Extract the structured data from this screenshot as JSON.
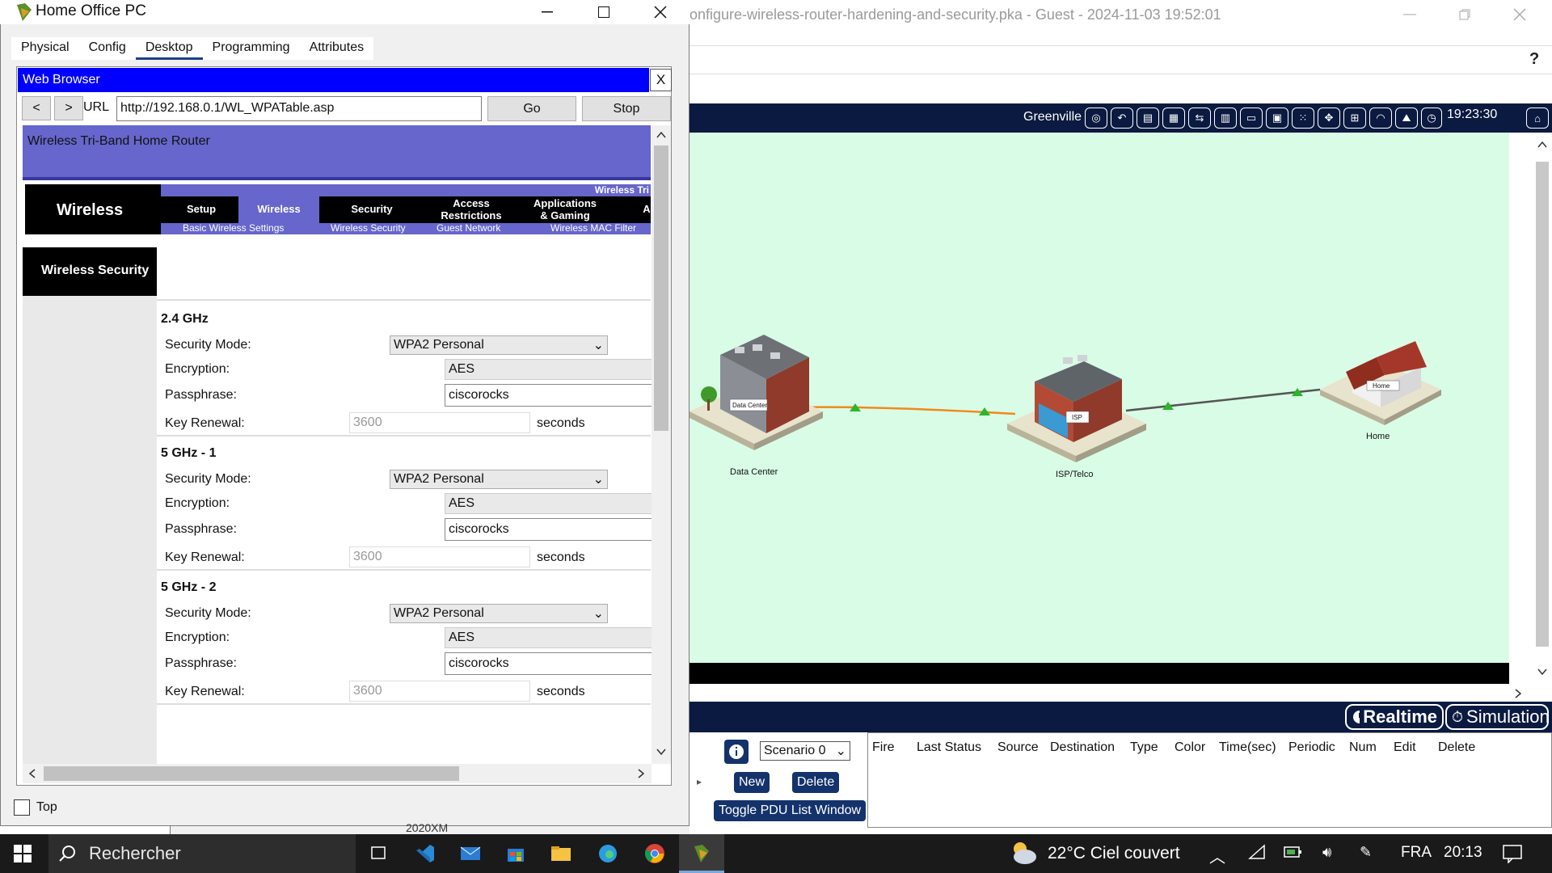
{
  "background_window": {
    "title": "onfigure-wireless-router-hardening-and-security.pka - Guest - 2024-11-03 19:52:01",
    "help_symbol": "?"
  },
  "topology_toolbar": {
    "location": "Greenville",
    "time": "19:23:30",
    "icons": [
      "navigation-icon",
      "undo-icon",
      "cluster-icon",
      "new-cluster-icon",
      "move-object-icon",
      "set-tiled-icon",
      "viewport-icon",
      "wireless-icon",
      "environment-icon",
      "clock-icon",
      "home-icon"
    ]
  },
  "topology": {
    "nodes": [
      {
        "name": "Data Center",
        "sign": "Data Center"
      },
      {
        "name": "ISP/Telco",
        "sign": "ISP"
      },
      {
        "name": "Home",
        "sign": "Home"
      }
    ],
    "link_colors": {
      "dc_isp": "#f08a1a",
      "isp_home": "#555555",
      "endpoint": "#2bb52b"
    }
  },
  "mode_buttons": {
    "realtime": "Realtime",
    "simulation": "Simulation"
  },
  "pdu_panel": {
    "scenario": "Scenario 0",
    "new_label": "New",
    "delete_label": "Delete",
    "toggle_label": "Toggle PDU List Window",
    "columns": [
      "Fire",
      "Last Status",
      "Source",
      "Destination",
      "Type",
      "Color",
      "Time(sec)",
      "Periodic",
      "Num",
      "Edit",
      "Delete"
    ]
  },
  "taskbar": {
    "search_placeholder": "Rechercher",
    "weather": "22°C  Ciel couvert",
    "language": "FRA",
    "time": "20:13"
  },
  "hopc": {
    "title": "Home Office PC",
    "tabs": [
      "Physical",
      "Config",
      "Desktop",
      "Programming",
      "Attributes"
    ],
    "active_tab": "Desktop",
    "top_label": "Top",
    "under_text": "2020XM"
  },
  "browser": {
    "title": "Web Browser",
    "close": "X",
    "back": "<",
    "forward": ">",
    "url_label": "URL",
    "url": "http://192.168.0.1/WL_WPATable.asp",
    "go": "Go",
    "stop": "Stop"
  },
  "router_page": {
    "banner": "Wireless Tri-Band Home Router",
    "nav_title": "Wireless",
    "strip_text": "Wireless Tri",
    "nav_items": [
      "Setup",
      "Wireless",
      "Security",
      "Access\nRestrictions",
      "Applications\n& Gaming",
      "A"
    ],
    "sub_items": [
      "Basic Wireless Settings",
      "Wireless Security",
      "Guest Network",
      "Wireless MAC Filter"
    ],
    "side_title": "Wireless Security",
    "labels": {
      "security_mode": "Security Mode:",
      "encryption": "Encryption:",
      "passphrase": "Passphrase:",
      "key_renewal": "Key Renewal:",
      "seconds": "seconds"
    },
    "bands": [
      {
        "name": "2.4 GHz",
        "security_mode": "WPA2 Personal",
        "encryption": "AES",
        "passphrase": "ciscorocks",
        "key_renewal": "3600"
      },
      {
        "name": "5 GHz - 1",
        "security_mode": "WPA2 Personal",
        "encryption": "AES",
        "passphrase": "ciscorocks",
        "key_renewal": "3600"
      },
      {
        "name": "5 GHz - 2",
        "security_mode": "WPA2 Personal",
        "encryption": "AES",
        "passphrase": "ciscorocks",
        "key_renewal": "3600"
      }
    ]
  }
}
